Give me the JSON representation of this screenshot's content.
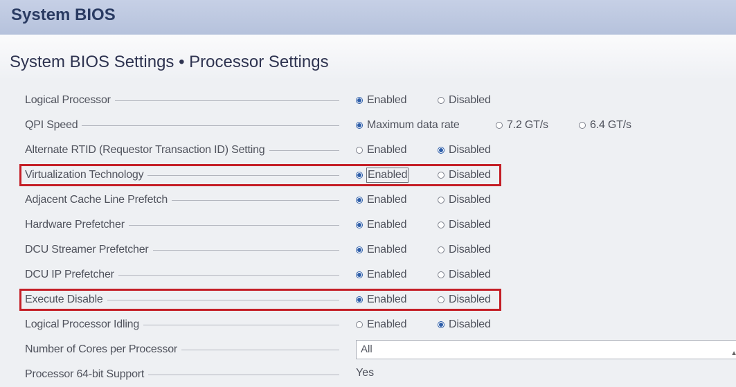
{
  "app_title": "System BIOS",
  "page_title": "System BIOS Settings • Processor Settings",
  "colors": {
    "header": "#b9c4dd",
    "highlight": "#c41e26",
    "radio_selected": "#2d5da8"
  },
  "settings": [
    {
      "label": "Logical Processor",
      "options": [
        "Enabled",
        "Disabled"
      ],
      "selected": 0
    },
    {
      "label": "QPI Speed",
      "options": [
        "Maximum data rate",
        "7.2 GT/s",
        "6.4 GT/s"
      ],
      "selected": 0
    },
    {
      "label": "Alternate RTID (Requestor Transaction ID) Setting",
      "options": [
        "Enabled",
        "Disabled"
      ],
      "selected": 1
    },
    {
      "label": "Virtualization Technology",
      "options": [
        "Enabled",
        "Disabled"
      ],
      "selected": 0,
      "highlighted": true,
      "focused": true
    },
    {
      "label": "Adjacent Cache Line Prefetch",
      "options": [
        "Enabled",
        "Disabled"
      ],
      "selected": 0
    },
    {
      "label": "Hardware Prefetcher",
      "options": [
        "Enabled",
        "Disabled"
      ],
      "selected": 0
    },
    {
      "label": "DCU Streamer Prefetcher",
      "options": [
        "Enabled",
        "Disabled"
      ],
      "selected": 0
    },
    {
      "label": "DCU IP Prefetcher",
      "options": [
        "Enabled",
        "Disabled"
      ],
      "selected": 0
    },
    {
      "label": "Execute Disable",
      "options": [
        "Enabled",
        "Disabled"
      ],
      "selected": 0,
      "highlighted": true
    },
    {
      "label": "Logical Processor Idling",
      "options": [
        "Enabled",
        "Disabled"
      ],
      "selected": 1
    },
    {
      "label": "Number of Cores per Processor",
      "dropdown": "All"
    },
    {
      "label": "Processor 64-bit Support",
      "value": "Yes"
    }
  ]
}
